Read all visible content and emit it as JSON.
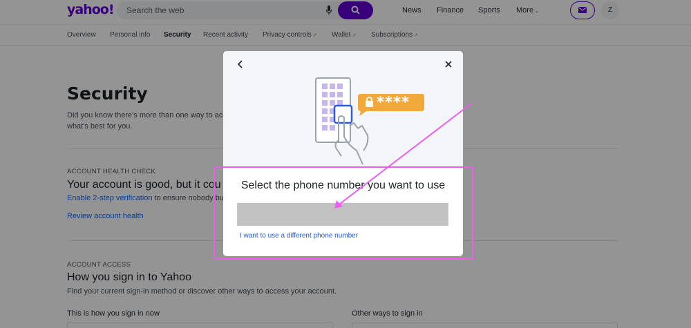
{
  "header": {
    "logo": "yahoo!",
    "search_placeholder": "Search the web",
    "nav": [
      "News",
      "Finance",
      "Sports",
      "More"
    ],
    "avatar_initial": "Z"
  },
  "tabs": [
    "Overview",
    "Personal info",
    "Security",
    "Recent activity",
    "Privacy controls",
    "Wallet",
    "Subscriptions"
  ],
  "page": {
    "title": "Security",
    "intro_line1": "Did you know there's more than one way to acc",
    "intro_line2": "what's best for you.",
    "health_label": "ACCOUNT HEALTH CHECK",
    "health_heading": "Your account is good, but it cou",
    "health_link": "Enable 2-step verification",
    "health_text": " to ensure nobody bu",
    "review_link": "Review account health",
    "access_label": "ACCOUNT ACCESS",
    "access_heading": "How you sign in to Yahoo",
    "access_text": "Find your current sign-in method or discover other ways to access your account.",
    "col_left": "This is how you sign in now",
    "col_right": "Other ways to sign in"
  },
  "modal": {
    "password_mask": "****",
    "title": "Select the phone number you want to use",
    "different_link": "I want to use a different phone number"
  },
  "colors": {
    "brand": "#6001d2",
    "link": "#0f69ff",
    "annotation": "#ee5cf2",
    "badge": "#f0a93a",
    "keypad": "#c5b6f0"
  }
}
